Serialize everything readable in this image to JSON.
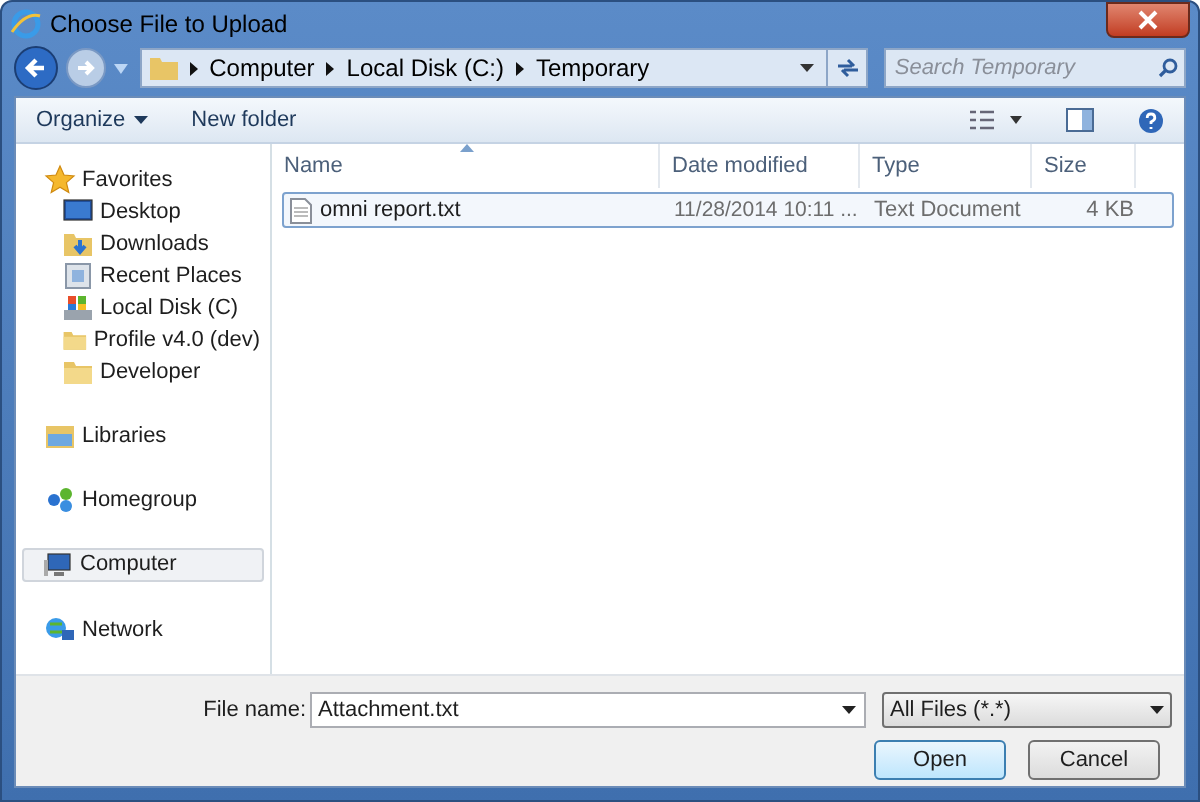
{
  "window": {
    "title": "Choose File to Upload"
  },
  "address_bar": {
    "crumbs": [
      "Computer",
      "Local Disk (C:)",
      "Temporary"
    ]
  },
  "search": {
    "placeholder": "Search Temporary"
  },
  "toolbar": {
    "organize": "Organize",
    "new_folder": "New folder"
  },
  "sidebar": {
    "groups": [
      {
        "label": "Favorites",
        "selected": false,
        "children": [
          {
            "label": "Desktop",
            "selected": false
          },
          {
            "label": "Downloads",
            "selected": false
          },
          {
            "label": "Recent Places",
            "selected": false
          },
          {
            "label": "Local Disk (C)",
            "selected": false
          },
          {
            "label": "Profile v4.0 (dev)",
            "selected": false
          },
          {
            "label": "Developer",
            "selected": false
          }
        ]
      },
      {
        "label": "Libraries",
        "selected": false
      },
      {
        "label": "Homegroup",
        "selected": false
      },
      {
        "label": "Computer",
        "selected": true
      },
      {
        "label": "Network",
        "selected": false
      }
    ]
  },
  "table": {
    "columns": [
      "Name",
      "Date modified",
      "Type",
      "Size"
    ],
    "rows": [
      {
        "name": "omni report.txt",
        "date": "11/28/2014 10:11 ...",
        "type": "Text Document",
        "size": "4 KB",
        "selected": true
      }
    ]
  },
  "file_name": {
    "label": "File name:",
    "value": "Attachment.txt"
  },
  "file_type": {
    "value": "All Files (*.*)"
  },
  "buttons": [
    {
      "label": "Open",
      "default": true
    },
    {
      "label": "Cancel",
      "default": false
    }
  ]
}
